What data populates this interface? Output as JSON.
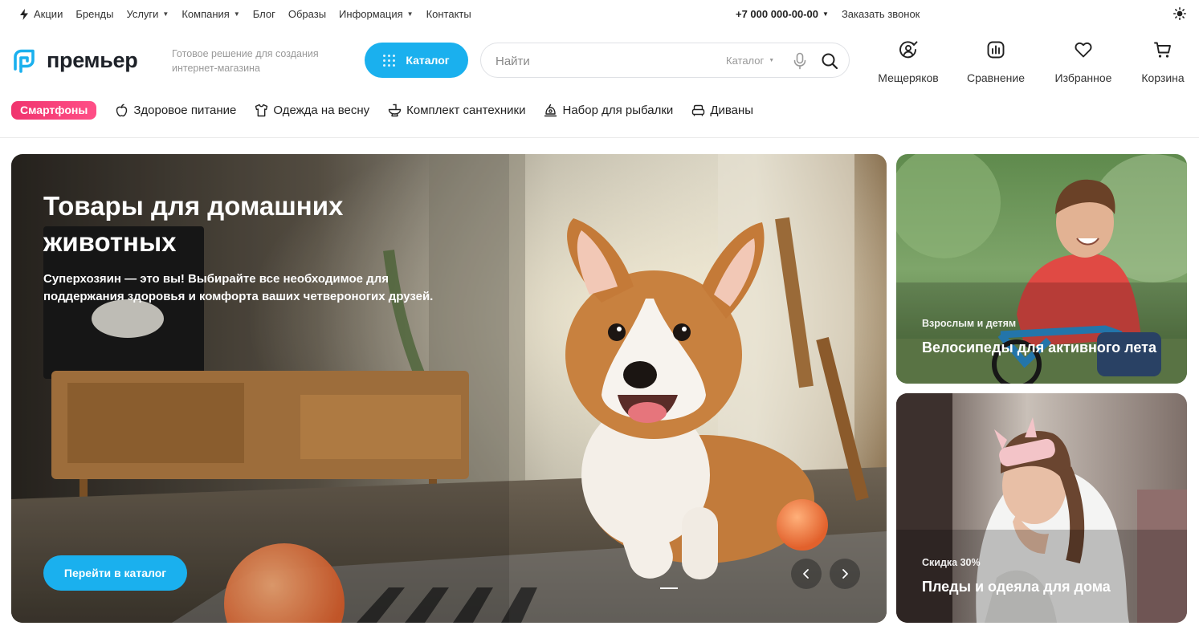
{
  "topbar": {
    "links": [
      {
        "label": "Акции"
      },
      {
        "label": "Бренды"
      },
      {
        "label": "Услуги"
      },
      {
        "label": "Компания"
      },
      {
        "label": "Блог"
      },
      {
        "label": "Образы"
      },
      {
        "label": "Информация"
      },
      {
        "label": "Контакты"
      }
    ],
    "phone": "+7 000 000-00-00",
    "callback": "Заказать звонок",
    "icons": {
      "promo": "lightning-icon",
      "theme": "sun-icon"
    }
  },
  "header": {
    "logo_text": "премьер",
    "tagline": "Готовое решение для создания интернет-магазина",
    "catalog_button": "Каталог",
    "search": {
      "placeholder": "Найти",
      "scope": "Каталог"
    },
    "actions": [
      {
        "label": "Мещеряков",
        "icon": "user-icon"
      },
      {
        "label": "Сравнение",
        "icon": "compare-icon"
      },
      {
        "label": "Избранное",
        "icon": "heart-icon"
      },
      {
        "label": "Корзина",
        "icon": "cart-icon"
      }
    ],
    "accent_color": "#1ab0ee"
  },
  "categories": {
    "highlight": "Смартфоны",
    "highlight_color": "#f0346e",
    "items": [
      {
        "label": "Здоровое питание",
        "icon": "apple-icon"
      },
      {
        "label": "Одежда на весну",
        "icon": "tshirt-icon"
      },
      {
        "label": "Комплект сантехники",
        "icon": "toilet-icon"
      },
      {
        "label": "Набор для рыбалки",
        "icon": "bell-icon"
      },
      {
        "label": "Диваны",
        "icon": "sofa-icon"
      }
    ]
  },
  "hero": {
    "title": "Товары для домашних животных",
    "subtitle": "Суперхозяин — это вы! Выбирайте все необходимое для поддержания здоровья и комфорта ваших четвероногих друзей.",
    "cta": "Перейти в каталог"
  },
  "side_banners": [
    {
      "caption": "Взрослым и детям",
      "title": "Велосипеды для активного лета"
    },
    {
      "caption": "Скидка 30%",
      "title": "Пледы и одеяла для дома"
    }
  ]
}
